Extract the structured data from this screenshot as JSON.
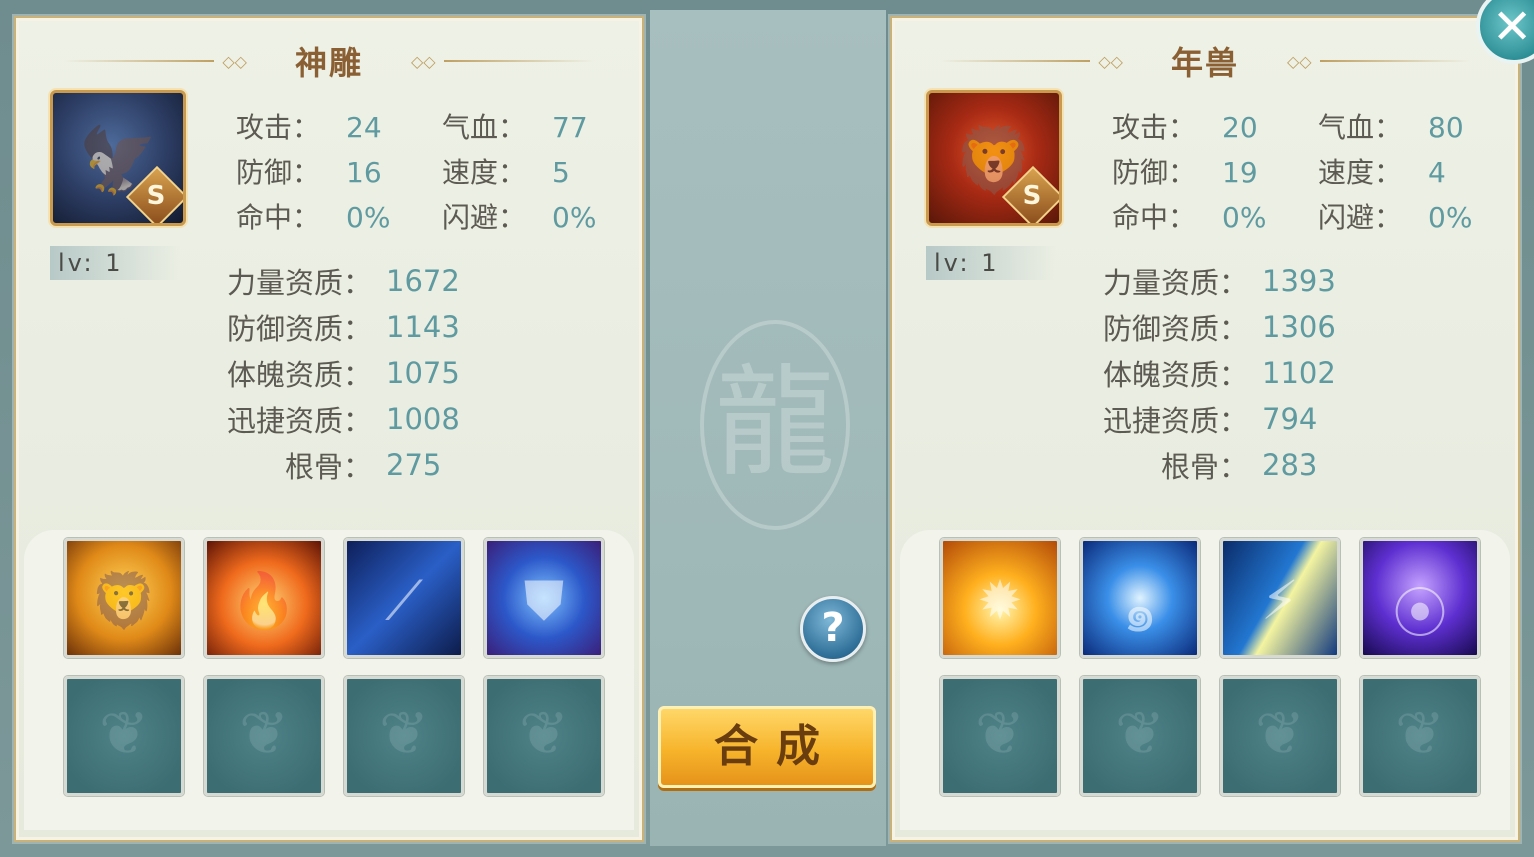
{
  "left_pet": {
    "name": "神雕",
    "rank": "S",
    "level": "lv: 1",
    "stats": [
      {
        "label": "攻击：",
        "value": "24"
      },
      {
        "label": "气血：",
        "value": "77"
      },
      {
        "label": "防御：",
        "value": "16"
      },
      {
        "label": "速度：",
        "value": "5"
      },
      {
        "label": "命中：",
        "value": "0%"
      },
      {
        "label": "闪避：",
        "value": "0%"
      }
    ],
    "qualities": [
      {
        "label": "力量资质：",
        "value": "1672"
      },
      {
        "label": "防御资质：",
        "value": "1143"
      },
      {
        "label": "体魄资质：",
        "value": "1075"
      },
      {
        "label": "迅捷资质：",
        "value": "1008"
      },
      {
        "label": "根骨：",
        "value": "275"
      }
    ],
    "skills": [
      "lion-roar-skill",
      "phoenix-skill",
      "claw-slash-skill",
      "shield-skill"
    ]
  },
  "right_pet": {
    "name": "年兽",
    "rank": "S",
    "level": "lv: 1",
    "stats": [
      {
        "label": "攻击：",
        "value": "20"
      },
      {
        "label": "气血：",
        "value": "80"
      },
      {
        "label": "防御：",
        "value": "19"
      },
      {
        "label": "速度：",
        "value": "4"
      },
      {
        "label": "命中：",
        "value": "0%"
      },
      {
        "label": "闪避：",
        "value": "0%"
      }
    ],
    "qualities": [
      {
        "label": "力量资质：",
        "value": "1393"
      },
      {
        "label": "防御资质：",
        "value": "1306"
      },
      {
        "label": "体魄资质：",
        "value": "1102"
      },
      {
        "label": "迅捷资质：",
        "value": "794"
      },
      {
        "label": "根骨：",
        "value": "283"
      }
    ],
    "skills": [
      "sun-burst-skill",
      "vortex-skill",
      "lightning-skill",
      "arcane-pillar-skill"
    ]
  },
  "actions": {
    "merge_label": "合成",
    "help_label": "?",
    "close_label": "✕"
  },
  "colors": {
    "label": "#5c5a52",
    "value": "#5f9aa0",
    "title": "#8a5f33",
    "merge_button": "#f7b42b"
  }
}
